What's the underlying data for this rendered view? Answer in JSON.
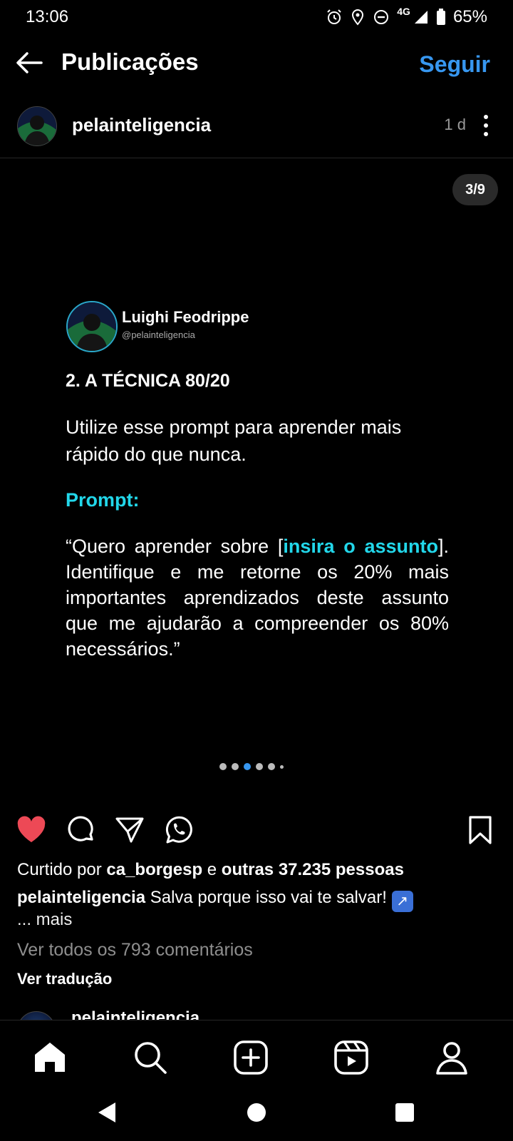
{
  "status_bar": {
    "time": "13:06",
    "network": "4G",
    "battery": "65%"
  },
  "header": {
    "title": "Publicações",
    "follow": "Seguir"
  },
  "post": {
    "username": "pelainteligencia",
    "age": "1 d",
    "counter": "3/9"
  },
  "slide": {
    "author": "Luighi Feodrippe",
    "handle": "@pelainteligencia",
    "heading": "2. A TÉCNICA 80/20",
    "intro": "Utilize esse prompt para aprender mais rápido do que nunca.",
    "prompt_label": "Prompt:",
    "quote_pre": "“Quero aprender sobre [",
    "quote_highlight": "insira o assunto",
    "quote_post": "]. Identifique e me retorne os 20% mais importantes aprendizados deste assunto que me ajudarão a compreender os 80% necessários.”"
  },
  "carousel_dots": {
    "total": 6,
    "active_index": 2
  },
  "likes": {
    "prefix": "Curtido por ",
    "user": "ca_borgesp",
    "middle": " e ",
    "others": "outras 37.235 pessoas"
  },
  "caption": {
    "user": "pelainteligencia",
    "text": " Salva porque isso vai te salvar! ",
    "emoji": "↗",
    "more": "... mais"
  },
  "comments": {
    "view_all": "Ver todos os 793 comentários",
    "translate": "Ver tradução"
  },
  "next_comment": {
    "username": "pelainteligencia"
  },
  "icons": {
    "back": "arrow-left-icon",
    "more": "vertical-dots-icon",
    "like": "heart-icon",
    "comment": "comment-icon",
    "share": "send-icon",
    "whatsapp": "whatsapp-icon",
    "save": "bookmark-icon",
    "nav": [
      "home-icon",
      "search-icon",
      "create-icon",
      "reels-icon",
      "profile-icon"
    ]
  },
  "colors": {
    "accent": "#3797f0",
    "like": "#ed4956",
    "highlight": "#22d7ea"
  }
}
